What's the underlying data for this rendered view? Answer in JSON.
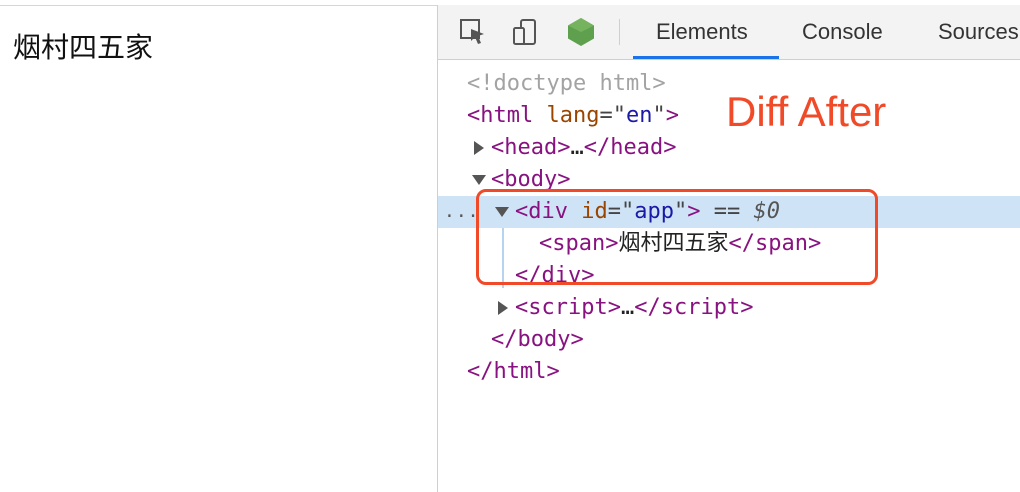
{
  "page": {
    "rendered_text": "烟村四五家"
  },
  "devtools": {
    "toolbar": {
      "icons": [
        "inspect-element-icon",
        "device-toolbar-icon",
        "node-icon"
      ],
      "tabs": [
        {
          "label": "Elements",
          "active": true
        },
        {
          "label": "Console",
          "active": false
        },
        {
          "label": "Sources",
          "active": false
        }
      ]
    },
    "dom": {
      "doctype": "<!doctype html>",
      "html_tag": "html",
      "lang_attr": "lang",
      "lang_val": "en",
      "head": "head",
      "body": "body",
      "div": "div",
      "id_attr": "id",
      "id_val": "app",
      "eq_marker": " == ",
      "dollar_ref": "$0",
      "span": "span",
      "span_text": "烟村四五家",
      "script": "script",
      "ellipsis_collapsed": "…",
      "selected_gutter": "..."
    }
  },
  "annotation": {
    "text": "Diff After",
    "color": "#f04a29"
  },
  "colors": {
    "tag": "#881280",
    "attr": "#994500",
    "value": "#1a1aa6",
    "selected_row": "#cfe3f7",
    "tab_underline": "#1a73e8"
  }
}
